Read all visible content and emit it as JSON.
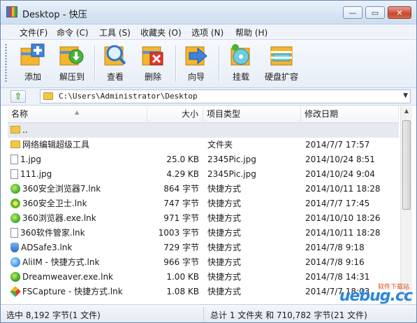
{
  "window": {
    "title": "Desktop - 快压"
  },
  "title_buttons": {
    "minimize": "—",
    "maximize": "▭",
    "close": "✕"
  },
  "menu": [
    "文件(F)",
    "命令 (C)",
    "工具 (S)",
    "收藏夹 (O)",
    "选项 (N)",
    "帮助 (H)"
  ],
  "toolbar": {
    "add": "添加",
    "extract": "解压到",
    "view": "查看",
    "delete": "删除",
    "wizard": "向导",
    "mount": "挂载",
    "disk": "硬盘扩容"
  },
  "address": {
    "path": "C:\\Users\\Administrator\\Desktop"
  },
  "columns": {
    "name": "名称",
    "size": "大小",
    "type": "项目类型",
    "date": "修改日期"
  },
  "files": [
    {
      "name": "..",
      "size": "",
      "type": "",
      "date": "",
      "icon": "folder-icon"
    },
    {
      "name": "网络编辑超级工具",
      "size": "",
      "type": "文件夹",
      "date": "2014/7/7 17:57",
      "icon": "folder-icon"
    },
    {
      "name": "1.jpg",
      "size": "25.0 KB",
      "type": "2345Pic.jpg",
      "date": "2014/10/24 8:51",
      "icon": "image-file-icon"
    },
    {
      "name": "111.jpg",
      "size": "4.29 KB",
      "type": "2345Pic.jpg",
      "date": "2014/10/24 9:04",
      "icon": "image-file-icon"
    },
    {
      "name": "360安全浏览器7.lnk",
      "size": "864 字节",
      "type": "快捷方式",
      "date": "2014/10/11 18:28",
      "icon": "browser-icon"
    },
    {
      "name": "360安全卫士.lnk",
      "size": "747 字节",
      "type": "快捷方式",
      "date": "2014/7/7 17:45",
      "icon": "security-guard-icon"
    },
    {
      "name": "360浏览器.exe.lnk",
      "size": "971 字节",
      "type": "快捷方式",
      "date": "2014/10/10 18:26",
      "icon": "browser-icon"
    },
    {
      "name": "360软件管家.lnk",
      "size": "1003 字节",
      "type": "快捷方式",
      "date": "2014/10/11 18:28",
      "icon": "software-manager-icon"
    },
    {
      "name": "ADSafe3.lnk",
      "size": "729 字节",
      "type": "快捷方式",
      "date": "2014/7/8 9:18",
      "icon": "shield-icon"
    },
    {
      "name": "AliIM - 快捷方式.lnk",
      "size": "966 字节",
      "type": "快捷方式",
      "date": "2014/7/8 9:16",
      "icon": "im-icon"
    },
    {
      "name": "Dreamweaver.exe.lnk",
      "size": "1.00 KB",
      "type": "快捷方式",
      "date": "2014/7/8 14:31",
      "icon": "dreamweaver-icon"
    },
    {
      "name": "FSCapture - 快捷方式.lnk",
      "size": "1.08 KB",
      "type": "快捷方式",
      "date": "2014/7/7 18:03",
      "icon": "capture-icon"
    }
  ],
  "status": {
    "selection": "选中 8,192 字节(1 文件)",
    "total": "总计 1 文件夹 和 710,782 字节(21 文件)"
  },
  "watermark": {
    "main": "uebug.cc",
    "tag": "软件下载站"
  }
}
